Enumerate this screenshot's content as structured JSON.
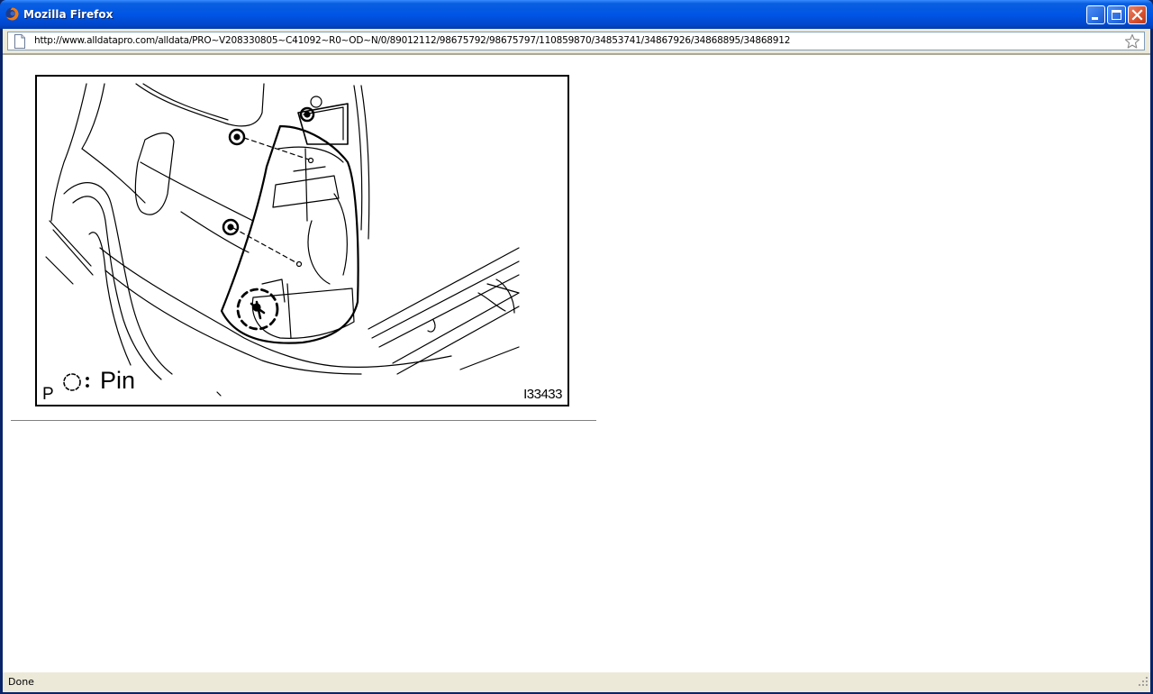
{
  "window": {
    "title": "Mozilla Firefox",
    "colors": {
      "titlebar": "#0055e5",
      "close_button": "#d9512d"
    }
  },
  "navbar": {
    "url": "http://www.alldatapro.com/alldata/PRO~V208330805~C41092~R0~OD~N/0/89012112/98675792/98675797/110859870/34853741/34867926/34868895/34868912",
    "page_icon": "page-icon",
    "bookmark_icon": "star-icon"
  },
  "figure": {
    "pin_legend": "Pin",
    "p_label": "P",
    "code": "I33433"
  },
  "statusbar": {
    "text": "Done"
  }
}
